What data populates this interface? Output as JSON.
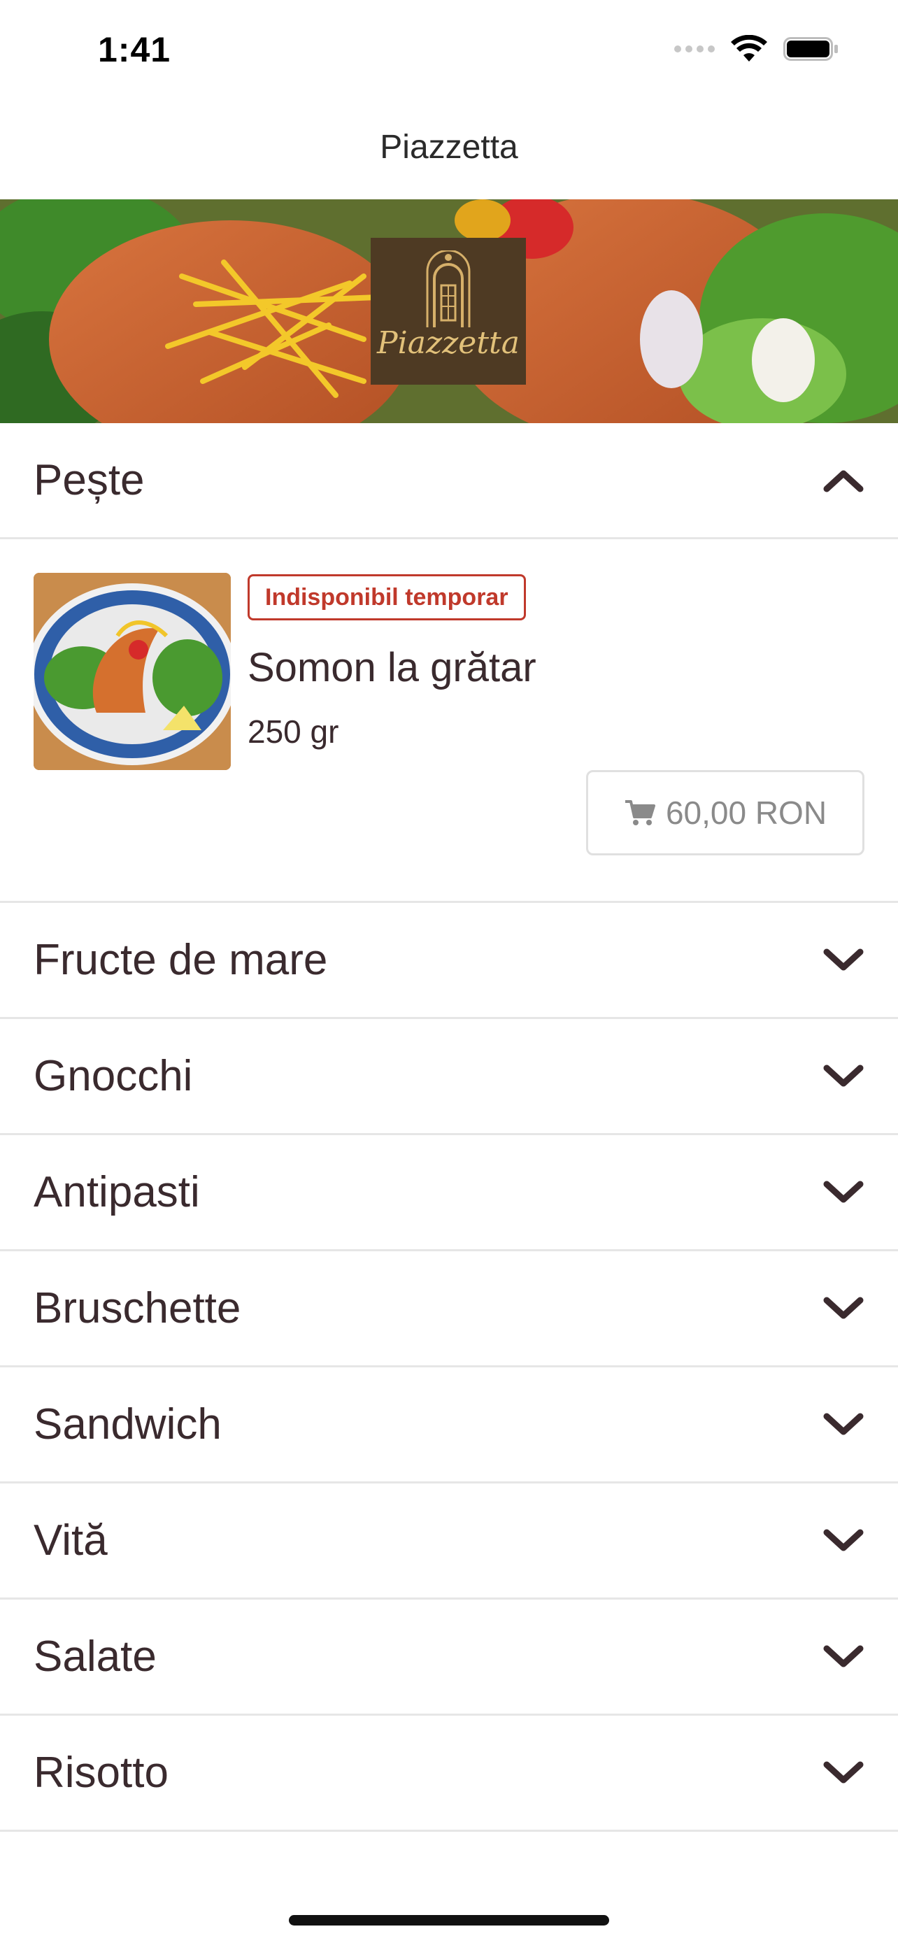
{
  "status_bar": {
    "time": "1:41"
  },
  "nav": {
    "title": "Piazzetta"
  },
  "hero": {
    "logo_text": "Piazzetta",
    "logo_color": "#4e3a23"
  },
  "expanded_category": {
    "label": "Pește",
    "state": "expanded",
    "icon": "chevron-up-icon"
  },
  "product": {
    "badge": "Indisponibil temporar",
    "name": "Somon la grătar",
    "weight": "250 gr",
    "price": "60,00 RON",
    "price_icon": "cart-icon"
  },
  "categories": [
    {
      "label": "Fructe de mare",
      "icon": "chevron-down-icon"
    },
    {
      "label": "Gnocchi",
      "icon": "chevron-down-icon"
    },
    {
      "label": "Antipasti",
      "icon": "chevron-down-icon"
    },
    {
      "label": "Bruschette",
      "icon": "chevron-down-icon"
    },
    {
      "label": "Sandwich",
      "icon": "chevron-down-icon"
    },
    {
      "label": "Vită",
      "icon": "chevron-down-icon"
    },
    {
      "label": "Salate",
      "icon": "chevron-down-icon"
    },
    {
      "label": "Risotto",
      "icon": "chevron-down-icon"
    }
  ],
  "colors": {
    "text": "#3a2a2e",
    "badge": "#c0392b",
    "divider": "#e6e6e6"
  }
}
